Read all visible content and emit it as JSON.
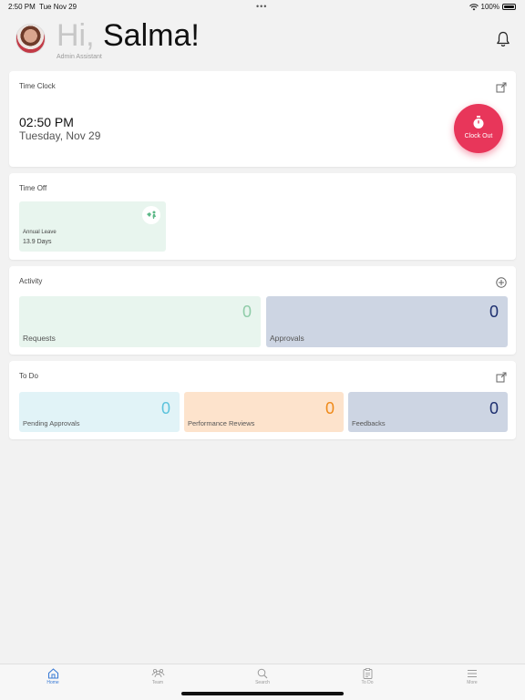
{
  "status": {
    "time": "2:50 PM",
    "date": "Tue Nov 29",
    "dots": "•••",
    "battery": "100%"
  },
  "header": {
    "hi": "Hi, ",
    "name": "Salma!",
    "role": "Admin Assistant"
  },
  "time_clock": {
    "title": "Time Clock",
    "time": "02:50 PM",
    "date": "Tuesday, Nov 29",
    "button_label": "Clock Out",
    "button_color": "#e8365a"
  },
  "time_off": {
    "title": "Time Off",
    "leave_label": "Annual Leave",
    "leave_value": "13.9 Days"
  },
  "activity": {
    "title": "Activity",
    "requests": {
      "count": "0",
      "label": "Requests"
    },
    "approvals": {
      "count": "0",
      "label": "Approvals"
    }
  },
  "todo": {
    "title": "To Do",
    "pending": {
      "count": "0",
      "label": "Pending Approvals"
    },
    "reviews": {
      "count": "0",
      "label": "Performance Reviews"
    },
    "feedbacks": {
      "count": "0",
      "label": "Feedbacks"
    }
  },
  "tabs": {
    "home": "Home",
    "team": "Team",
    "search": "Search",
    "todo": "To Do",
    "more": "More"
  },
  "colors": {
    "accent": "#3a7bd5",
    "requests_bg": "#e8f5ee",
    "requests_fg": "#8fcca8",
    "approvals_bg": "#cdd5e3",
    "approvals_fg": "#1d2f6f",
    "pending_bg": "#e1f3f7",
    "pending_fg": "#5cc3dc",
    "reviews_bg": "#fde3cc",
    "reviews_fg": "#ef8a1a",
    "feedbacks_bg": "#cdd5e3",
    "feedbacks_fg": "#1d2f6f"
  }
}
